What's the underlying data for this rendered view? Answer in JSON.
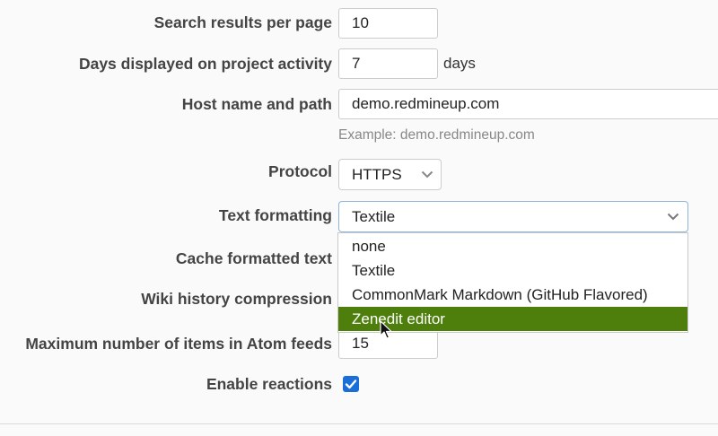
{
  "form": {
    "search_results": {
      "label": "Search results per page",
      "value": "10"
    },
    "days_displayed": {
      "label": "Days displayed on project activity",
      "value": "7",
      "unit": "days"
    },
    "host_name": {
      "label": "Host name and path",
      "value": "demo.redmineup.com",
      "hint": "Example: demo.redmineup.com"
    },
    "protocol": {
      "label": "Protocol",
      "value": "HTTPS"
    },
    "text_formatting": {
      "label": "Text formatting",
      "value": "Textile",
      "options": [
        "none",
        "Textile",
        "CommonMark Markdown (GitHub Flavored)",
        "Zenedit editor"
      ],
      "highlighted_index": 3
    },
    "cache_formatted_text": {
      "label": "Cache formatted text"
    },
    "wiki_history_compression": {
      "label": "Wiki history compression"
    },
    "max_atom_items": {
      "label": "Maximum number of items in Atom feeds",
      "value": "15"
    },
    "enable_reactions": {
      "label": "Enable reactions",
      "checked": true
    }
  },
  "colors": {
    "highlight": "#4e7f0c",
    "checkbox": "#1a6ed8",
    "focus_border": "#8eb4d9"
  },
  "icons": {
    "select_arrow": "chevron-down-icon",
    "checkbox": "checkmark-icon",
    "pointer": "mouse-pointer-icon"
  }
}
